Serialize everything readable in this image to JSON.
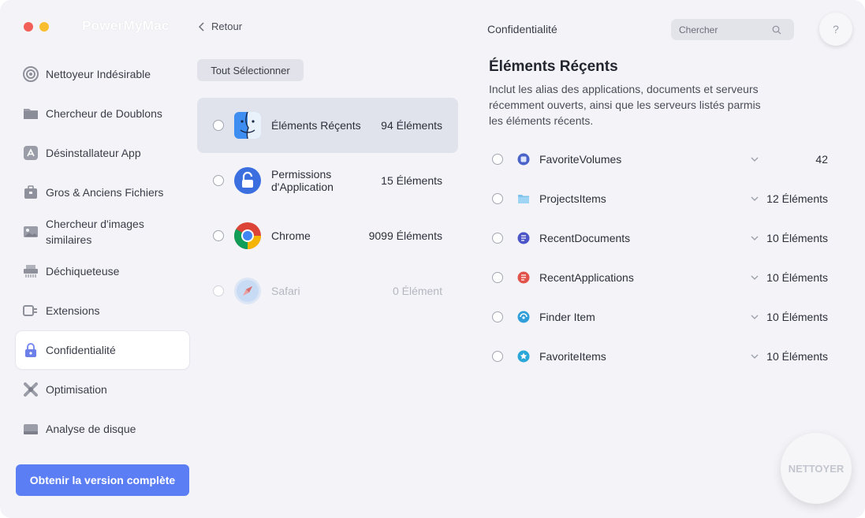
{
  "app": {
    "title": "PowerMyMac"
  },
  "sidebar": {
    "items": [
      {
        "label": "Nettoyeur Indésirable",
        "icon": "junk-cleaner-icon"
      },
      {
        "label": "Chercheur de Doublons",
        "icon": "folder-icon"
      },
      {
        "label": "Désinstallateur App",
        "icon": "app-uninstaller-icon"
      },
      {
        "label": "Gros & Anciens Fichiers",
        "icon": "briefcase-icon"
      },
      {
        "label": "Chercheur d'images similaires",
        "icon": "image-icon"
      },
      {
        "label": "Déchiqueteuse",
        "icon": "shredder-icon"
      },
      {
        "label": "Extensions",
        "icon": "plug-icon"
      },
      {
        "label": "Confidentialité",
        "icon": "lock-icon",
        "active": true
      },
      {
        "label": "Optimisation",
        "icon": "optimization-icon"
      },
      {
        "label": "Analyse de disque",
        "icon": "disk-icon"
      }
    ],
    "upgrade_label": "Obtenir la version complète"
  },
  "middle": {
    "back_label": "Retour",
    "select_all_label": "Tout Sélectionner",
    "rows": [
      {
        "name": "Éléments Réçents",
        "count": "94 Éléments",
        "icon": "finder-icon",
        "selected": true
      },
      {
        "name": "Permissions d'Application",
        "count": "15 Éléments",
        "icon": "permissions-lock-icon"
      },
      {
        "name": "Chrome",
        "count": "9099 Éléments",
        "icon": "chrome-icon"
      },
      {
        "name": "Safari",
        "count": "0 Élément",
        "icon": "safari-icon",
        "disabled": true
      }
    ]
  },
  "right": {
    "header": "Confidentialité",
    "search_placeholder": "Chercher",
    "help_label": "?",
    "title": "Éléments Réçents",
    "description": "Inclut les alias des applications, documents et serveurs récemment ouverts, ainsi que les serveurs listés parmis les éléments récents.",
    "rows": [
      {
        "name": "FavoriteVolumes",
        "count": "42",
        "icon": "volume-icon"
      },
      {
        "name": "ProjectsItems",
        "count": "12 Éléments",
        "icon": "folder-icon"
      },
      {
        "name": "RecentDocuments",
        "count": "10 Éléments",
        "icon": "document-icon"
      },
      {
        "name": "RecentApplications",
        "count": "10 Éléments",
        "icon": "application-icon"
      },
      {
        "name": "Finder Item",
        "count": "10 Éléments",
        "icon": "finder-item-icon"
      },
      {
        "name": "FavoriteItems",
        "count": "10 Éléments",
        "icon": "star-icon"
      }
    ],
    "clean_label": "NETTOYER"
  },
  "colors": {
    "accent": "#5b7ef5",
    "selected_row": "#e1e3ec",
    "background": "#f4f4f8"
  }
}
